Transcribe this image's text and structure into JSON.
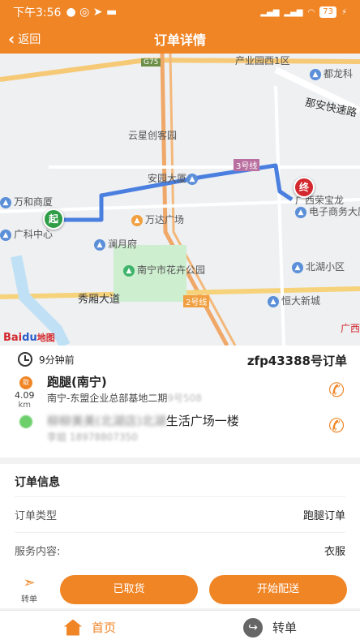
{
  "status_bar": {
    "time": "下午3:56",
    "battery": "73"
  },
  "nav": {
    "back_label": "返回",
    "title": "订单详情"
  },
  "map": {
    "labels": [
      "产业园西1区",
      "都龙科",
      "那安快速路",
      "云星创客园",
      "安园大厦",
      "3号线",
      "广西荣宝龙",
      "电子商务大厦",
      "万和商厦",
      "广科中心",
      "万达广场",
      "澜月府",
      "南宁市花卉公园",
      "北湖小区",
      "秀厢大道",
      "2号线",
      "恒大新城",
      "G75",
      "广西"
    ],
    "start_pin": "起",
    "end_pin": "终",
    "logo": {
      "a": "Bai",
      "b": "du",
      "c": "地图"
    }
  },
  "order": {
    "time_ago": "9分钟前",
    "order_no": "zfp43388号订单",
    "pickup_badge": "取",
    "distance": "4.09",
    "distance_unit": "km",
    "pickup_title": "跑腿(南宁)",
    "pickup_addr": "南宁-东盟企业总部基地二期",
    "pickup_addr_blur": "9号508",
    "drop_title_blur": "柳柳美美(北湖店)北湖",
    "drop_title": "生活广场一楼",
    "drop_contact": "李姐 18978807350"
  },
  "info": {
    "header": "订单信息",
    "rows": [
      {
        "label": "订单类型",
        "value": "跑腿订单"
      },
      {
        "label": "服务内容:",
        "value": "衣服"
      }
    ]
  },
  "actions": {
    "transfer": "转单",
    "picked": "已取货",
    "deliver": "开始配送"
  },
  "tabs": [
    {
      "label": "首页"
    },
    {
      "label": "转单"
    }
  ],
  "colors": {
    "primary": "#f08526",
    "route": "#4a7fe0"
  }
}
